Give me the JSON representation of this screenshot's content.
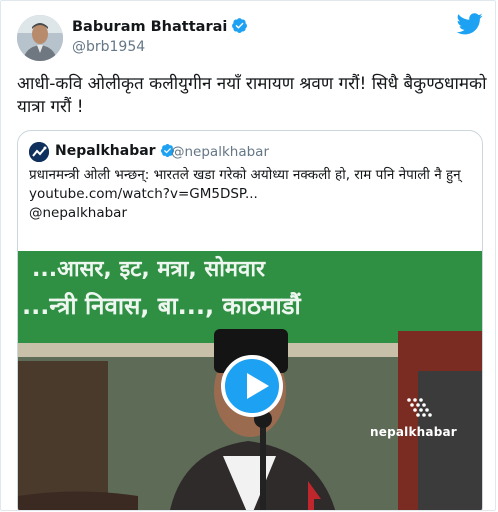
{
  "author": {
    "name": "Baburam Bhattarai",
    "handle": "@brb1954"
  },
  "tweet": {
    "text": "आधी-कवि ओलीकृत कलीयुगीन नयाँ रामायण श्रवण गरौं! सिधै बैकुण्ठधामको यात्रा गरौं !"
  },
  "quote": {
    "name": "Nepalkhabar",
    "handle": "@nepalkhabar",
    "text": "प्रधानमन्त्री ओली भन्छन्: भारतले खडा गरेको अयोध्या नक्कली हो, राम पनि नेपाली नै हुन्",
    "link": "youtube.com/watch?v=GM5DSP...",
    "mention": "@nepalkhabar"
  },
  "video": {
    "banner_line1": "...आसर, इट, मत्रा, सोमवार",
    "banner_line2": "...न्त्री निवास, बा..., काठमाडौं",
    "watermark": "nepalkhabar",
    "play_icon": "play-icon"
  },
  "colors": {
    "twitter_blue": "#1da1f2",
    "text": "#14171a",
    "muted": "#657786",
    "banner_green": "#3a8a3a"
  }
}
